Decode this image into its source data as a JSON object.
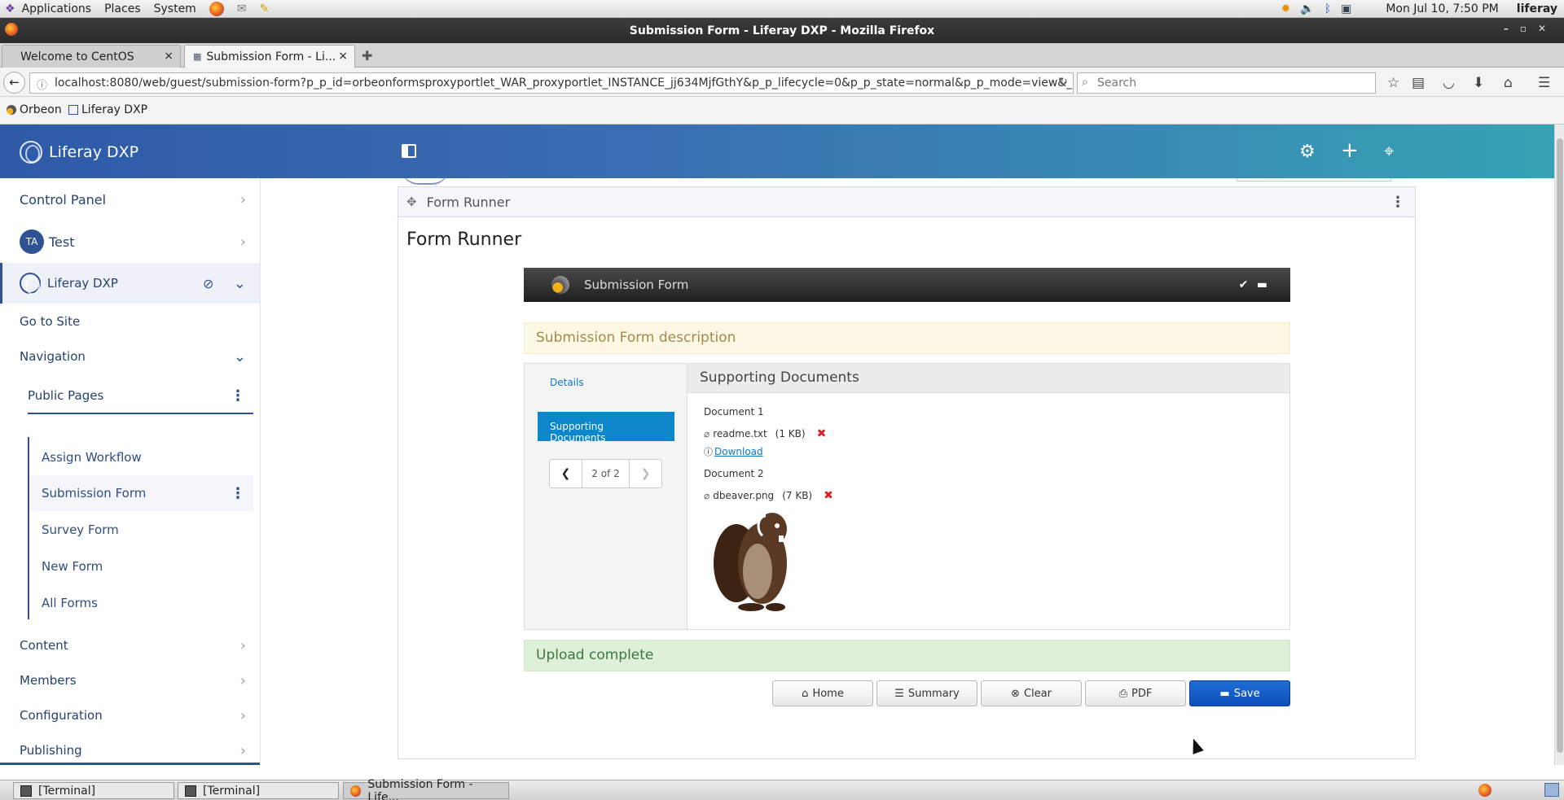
{
  "gnome_panel": {
    "menus": [
      "Applications",
      "Places",
      "System"
    ],
    "clock": "Mon Jul 10,  7:50 PM",
    "user": "liferay"
  },
  "window": {
    "title": "Submission Form - Liferay DXP - Mozilla Firefox"
  },
  "tabs": [
    {
      "label": "Welcome to CentOS",
      "close": "×"
    },
    {
      "label": "Submission Form - Li...",
      "close": "×"
    }
  ],
  "navbar": {
    "url": "localhost:8080/web/guest/submission-form?p_p_id=orbeonformsproxyportlet_WAR_proxyportlet_INSTANCE_jj634MjfGthY&p_p_lifecycle=0&p_p_state=normal&p_p_mode=view&_ort",
    "search_placeholder": "Search"
  },
  "bookmarks": [
    "Orbeon",
    "Liferay DXP"
  ],
  "liferay": {
    "brand": "Liferay DXP"
  },
  "sidebar": {
    "control_panel": "Control Panel",
    "user_initials": "TA",
    "user_label": "Test",
    "site": "Liferay DXP",
    "go_to_site": "Go to Site",
    "navigation": "Navigation",
    "public_pages": "Public Pages",
    "pages": [
      "Assign Workflow",
      "Submission Form",
      "Survey Form",
      "New Form",
      "All Forms"
    ],
    "sections": [
      "Content",
      "Members",
      "Configuration",
      "Publishing"
    ]
  },
  "portlet": {
    "header": "Form Runner",
    "title": "Form Runner"
  },
  "form": {
    "name": "Submission Form",
    "description": "Submission Form description",
    "wizard": {
      "items": [
        "Details",
        "Supporting Documents"
      ],
      "active": "Supporting Documents",
      "page_indicator": "2 of 2"
    },
    "section_title": "Supporting Documents",
    "documents": [
      {
        "label": "Document 1",
        "filename": "readme.txt",
        "size": "(1 KB)",
        "download": "Download"
      },
      {
        "label": "Document 2",
        "filename": "dbeaver.png",
        "size": "(7 KB)"
      }
    ],
    "upload_status": "Upload complete",
    "buttons": {
      "home": "Home",
      "summary": "Summary",
      "clear": "Clear",
      "pdf": "PDF",
      "save": "Save"
    }
  },
  "taskbar": [
    {
      "label": "[Terminal]"
    },
    {
      "label": "[Terminal]"
    },
    {
      "label": "Submission Form - Life..."
    }
  ]
}
